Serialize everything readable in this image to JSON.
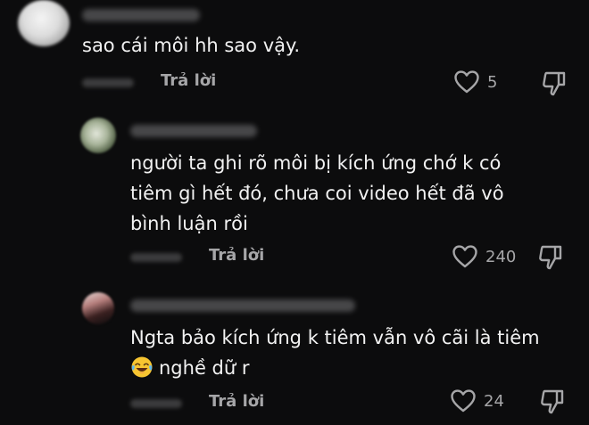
{
  "comments": [
    {
      "text": "sao cái môi hh sao vậy.",
      "reply_label": "Trả lời",
      "likes": "5",
      "avatar_icon": "blurred-avatar",
      "username_blurred": true
    },
    {
      "text": "người ta ghi rõ môi bị kích ứng chớ k có\ntiêm gì hết đó, chưa coi video hết đã vô\nbình luận rồi",
      "reply_label": "Trả lời",
      "likes": "240",
      "avatar_icon": "blurred-avatar",
      "username_blurred": true
    },
    {
      "text_line1": "Ngta bảo kích ứng k tiêm vẫn vô cãi là tiêm",
      "text_line2": "nghề dữ r",
      "emoji_icon": "laughing-tears-emoji",
      "reply_label": "Trả lời",
      "likes": "24",
      "avatar_icon": "blurred-avatar",
      "username_blurred": true
    }
  ],
  "icons": {
    "like": "heart-outline-icon",
    "dislike": "thumbs-down-outline-icon"
  },
  "colors": {
    "background": "#0c0c0d",
    "text": "#f2f2f2",
    "meta": "#a6a6a8"
  }
}
